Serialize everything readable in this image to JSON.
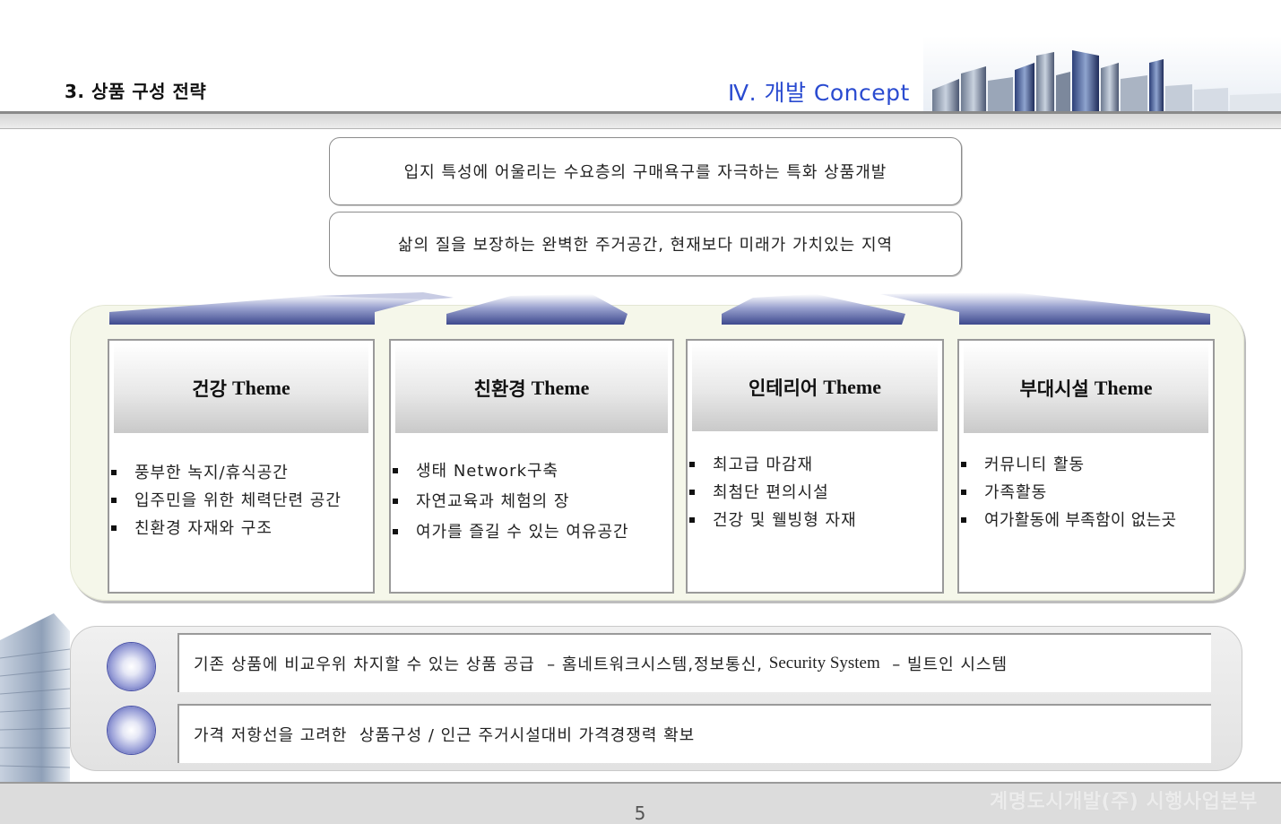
{
  "header": {
    "section_title": "3. 상품 구성 전략",
    "chapter_title": "Ⅳ.  개발 Concept"
  },
  "goals": [
    "입지 특성에 어울리는 수요층의 구매욕구를 자극하는 특화 상품개발",
    "삶의 질을 보장하는 완벽한 주거공간, 현재보다 미래가 가치있는 지역"
  ],
  "themes": [
    {
      "title_ko": "건강",
      "title_en": "Theme",
      "items": [
        "풍부한 녹지/휴식공간",
        "입주민을 위한 체력단련 공간",
        "친환경 자재와 구조"
      ]
    },
    {
      "title_ko": "친환경",
      "title_en": "Theme",
      "items": [
        "생태 Network구축",
        "자연교육과 체험의 장",
        "여가를 즐길 수 있는 여유공간"
      ]
    },
    {
      "title_ko": "인테리어",
      "title_en": "Theme",
      "items": [
        "최고급 마감재",
        "최첨단 편의시설",
        "건강 및 웰빙형 자재"
      ]
    },
    {
      "title_ko": "부대시설",
      "title_en": "Theme",
      "items": [
        "커뮤니티 활동",
        "가족활동",
        "여가활동에 부족함이 없는곳"
      ]
    }
  ],
  "strategies": [
    {
      "part1": "기존 상품에 비교우위 차지할 수 있는 상품 공급  – 홈네트워크시스템,정보통신, ",
      "part2": "Security System",
      "part3": "  – 빌트인 시스템"
    },
    {
      "part1": "가격 저항선을 고려한  상품구성 / 인근 주거시설대비 가격경쟁력 확보"
    }
  ],
  "footer": {
    "page_number": "5",
    "company": "계명도시개발(주) 시행사업본부"
  },
  "colors": {
    "chapter_title": "#2a4bd0",
    "arrow": "#5a66a6",
    "theme_panel": "#f5f7ea",
    "orb": "#2f3a9c"
  }
}
